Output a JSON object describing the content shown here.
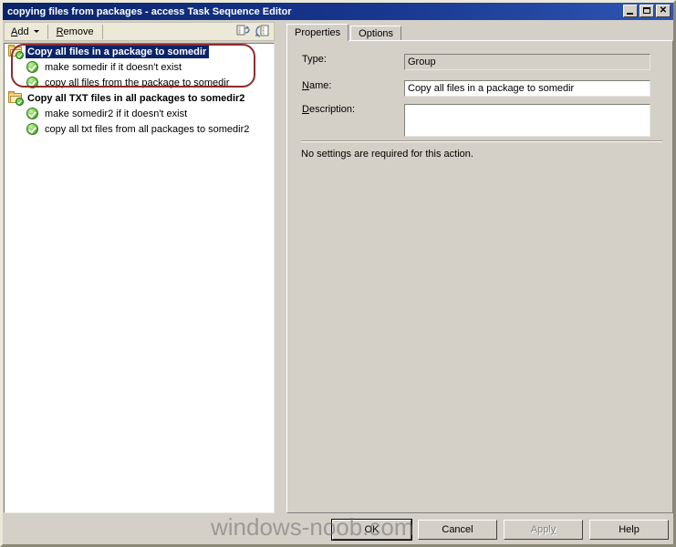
{
  "window": {
    "title": "copying files from packages - access Task Sequence Editor",
    "buttons": {
      "minimize": "minimize-button",
      "maximize": "maximize-button",
      "close": "✕"
    }
  },
  "toolbar": {
    "add_label": "Add",
    "add_accel": "A",
    "remove_label": "Remove",
    "remove_accel": "R",
    "icon_1": "indent-action-icon",
    "icon_2": "move-action-icon"
  },
  "tree": {
    "items": [
      {
        "label": "Copy all files in a package to somedir",
        "type": "group",
        "icon": "folder-check-icon",
        "selected": true,
        "children": [
          {
            "label": "make somedir if it doesn't exist",
            "icon": "green-check-icon"
          },
          {
            "label": "copy all files from the package to somedir",
            "icon": "green-check-icon"
          }
        ]
      },
      {
        "label": "Copy all TXT files in all packages to somedir2",
        "type": "group",
        "icon": "folder-check-icon",
        "selected": false,
        "children": [
          {
            "label": "make somedir2 if it doesn't exist",
            "icon": "green-check-icon"
          },
          {
            "label": "copy all txt files from all packages to somedir2",
            "icon": "green-check-icon"
          }
        ]
      }
    ],
    "annotation_color": "#8f2b2b"
  },
  "tabs": [
    {
      "label": "Properties",
      "active": true
    },
    {
      "label": "Options",
      "active": false
    }
  ],
  "properties": {
    "type_label": "Type:",
    "type_value": "Group",
    "name_label": "Name:",
    "name_accel": "N",
    "name_value": "Copy all files in a package to somedir",
    "description_label": "Description:",
    "description_accel": "D",
    "description_value": "",
    "note": "No settings are required  for this action."
  },
  "dialog_buttons": {
    "ok": "OK",
    "cancel": "Cancel",
    "apply": "Apply",
    "apply_accel": "y",
    "help": "Help"
  },
  "watermark": {
    "text": "windows-noob.com"
  },
  "colors": {
    "titlebar_start": "#0a246a",
    "titlebar_end": "#2f55b4",
    "selection": "#0a246a",
    "face": "#d4d0c8",
    "toolbar_face": "#ece9d8",
    "annotation": "#8f2b2b"
  }
}
